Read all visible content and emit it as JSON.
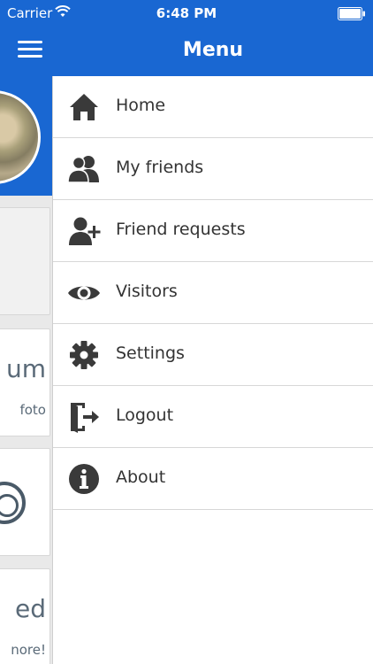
{
  "status_bar": {
    "carrier": "Carrier",
    "time": "6:48 PM"
  },
  "nav_bar": {
    "title": "Menu"
  },
  "background": {
    "cards": [
      {
        "title": "um",
        "subtitle": "foto"
      },
      {
        "title": "",
        "subtitle": ""
      },
      {
        "title": "ed",
        "subtitle": "nore!"
      }
    ]
  },
  "menu": {
    "items": [
      {
        "label": "Home",
        "icon": "home-icon"
      },
      {
        "label": "My friends",
        "icon": "friends-icon"
      },
      {
        "label": "Friend requests",
        "icon": "add-friend-icon"
      },
      {
        "label": "Visitors",
        "icon": "eye-icon"
      },
      {
        "label": "Settings",
        "icon": "gear-icon"
      },
      {
        "label": "Logout",
        "icon": "logout-icon"
      },
      {
        "label": "About",
        "icon": "info-icon"
      }
    ]
  },
  "colors": {
    "accent": "#1967d2",
    "icon": "#3a3a3a"
  }
}
